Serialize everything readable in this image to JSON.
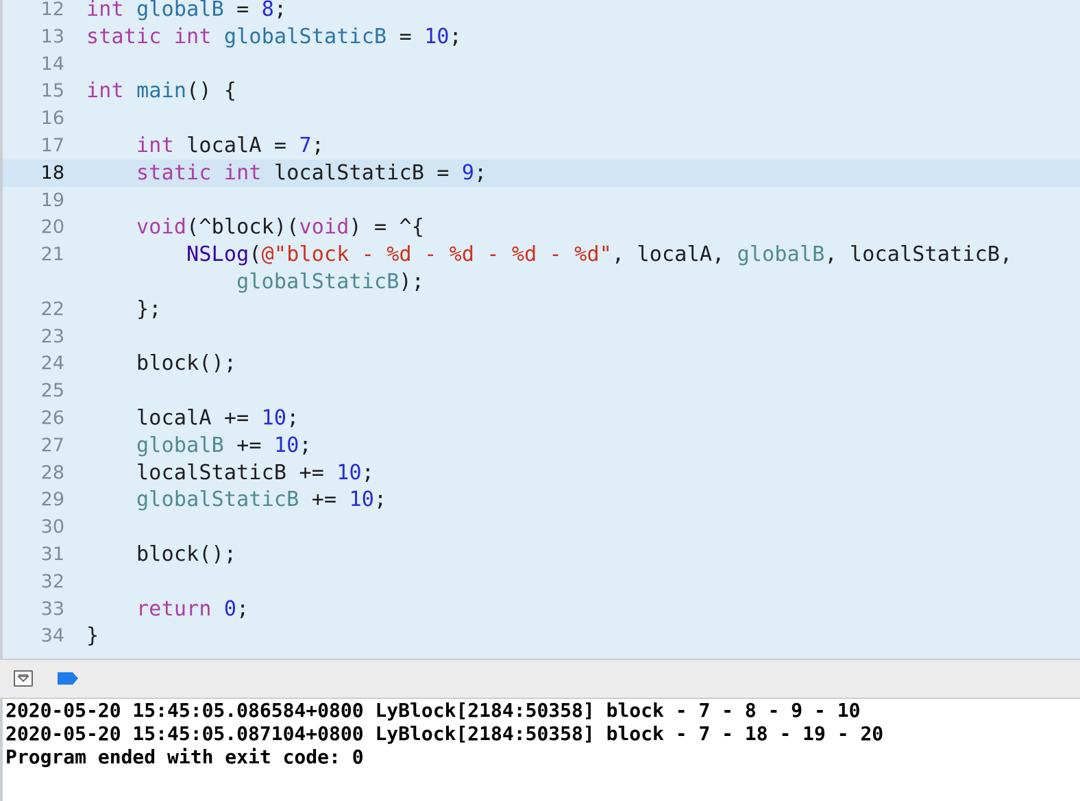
{
  "editor": {
    "current_line": "18",
    "lines": [
      {
        "num": "12",
        "tokens": [
          {
            "t": "int",
            "c": "keyword"
          },
          {
            "t": " ",
            "c": "plain"
          },
          {
            "t": "globalB",
            "c": "decl"
          },
          {
            "t": " = ",
            "c": "plain"
          },
          {
            "t": "8",
            "c": "number"
          },
          {
            "t": ";",
            "c": "plain"
          }
        ]
      },
      {
        "num": "13",
        "tokens": [
          {
            "t": "static",
            "c": "keyword"
          },
          {
            "t": " ",
            "c": "plain"
          },
          {
            "t": "int",
            "c": "keyword"
          },
          {
            "t": " ",
            "c": "plain"
          },
          {
            "t": "globalStaticB",
            "c": "decl"
          },
          {
            "t": " = ",
            "c": "plain"
          },
          {
            "t": "10",
            "c": "number"
          },
          {
            "t": ";",
            "c": "plain"
          }
        ]
      },
      {
        "num": "14",
        "tokens": []
      },
      {
        "num": "15",
        "tokens": [
          {
            "t": "int",
            "c": "keyword"
          },
          {
            "t": " ",
            "c": "plain"
          },
          {
            "t": "main",
            "c": "decl"
          },
          {
            "t": "() {",
            "c": "plain"
          }
        ]
      },
      {
        "num": "16",
        "tokens": []
      },
      {
        "num": "17",
        "tokens": [
          {
            "t": "    ",
            "c": "plain"
          },
          {
            "t": "int",
            "c": "keyword"
          },
          {
            "t": " localA = ",
            "c": "plain"
          },
          {
            "t": "7",
            "c": "number"
          },
          {
            "t": ";",
            "c": "plain"
          }
        ]
      },
      {
        "num": "18",
        "tokens": [
          {
            "t": "    ",
            "c": "plain"
          },
          {
            "t": "static",
            "c": "keyword"
          },
          {
            "t": " ",
            "c": "plain"
          },
          {
            "t": "int",
            "c": "keyword"
          },
          {
            "t": " localStaticB = ",
            "c": "plain"
          },
          {
            "t": "9",
            "c": "number"
          },
          {
            "t": ";",
            "c": "plain"
          }
        ]
      },
      {
        "num": "19",
        "tokens": []
      },
      {
        "num": "20",
        "tokens": [
          {
            "t": "    ",
            "c": "plain"
          },
          {
            "t": "void",
            "c": "keyword"
          },
          {
            "t": "(^block)(",
            "c": "plain"
          },
          {
            "t": "void",
            "c": "keyword"
          },
          {
            "t": ") = ^{",
            "c": "plain"
          }
        ]
      },
      {
        "num": "21",
        "tokens": [
          {
            "t": "        ",
            "c": "plain"
          },
          {
            "t": "NSLog",
            "c": "func"
          },
          {
            "t": "(",
            "c": "plain"
          },
          {
            "t": "@\"block - %d - %d - %d - %d\"",
            "c": "string"
          },
          {
            "t": ", localA, ",
            "c": "plain"
          },
          {
            "t": "globalB",
            "c": "global"
          },
          {
            "t": ", localStaticB,",
            "c": "plain"
          }
        ]
      },
      {
        "num": "",
        "tokens": [
          {
            "t": "            ",
            "c": "plain"
          },
          {
            "t": "globalStaticB",
            "c": "global"
          },
          {
            "t": ");",
            "c": "plain"
          }
        ]
      },
      {
        "num": "22",
        "tokens": [
          {
            "t": "    };",
            "c": "plain"
          }
        ]
      },
      {
        "num": "23",
        "tokens": []
      },
      {
        "num": "24",
        "tokens": [
          {
            "t": "    block();",
            "c": "plain"
          }
        ]
      },
      {
        "num": "25",
        "tokens": []
      },
      {
        "num": "26",
        "tokens": [
          {
            "t": "    localA += ",
            "c": "plain"
          },
          {
            "t": "10",
            "c": "number"
          },
          {
            "t": ";",
            "c": "plain"
          }
        ]
      },
      {
        "num": "27",
        "tokens": [
          {
            "t": "    ",
            "c": "plain"
          },
          {
            "t": "globalB",
            "c": "global"
          },
          {
            "t": " += ",
            "c": "plain"
          },
          {
            "t": "10",
            "c": "number"
          },
          {
            "t": ";",
            "c": "plain"
          }
        ]
      },
      {
        "num": "28",
        "tokens": [
          {
            "t": "    localStaticB += ",
            "c": "plain"
          },
          {
            "t": "10",
            "c": "number"
          },
          {
            "t": ";",
            "c": "plain"
          }
        ]
      },
      {
        "num": "29",
        "tokens": [
          {
            "t": "    ",
            "c": "plain"
          },
          {
            "t": "globalStaticB",
            "c": "global"
          },
          {
            "t": " += ",
            "c": "plain"
          },
          {
            "t": "10",
            "c": "number"
          },
          {
            "t": ";",
            "c": "plain"
          }
        ]
      },
      {
        "num": "30",
        "tokens": []
      },
      {
        "num": "31",
        "tokens": [
          {
            "t": "    block();",
            "c": "plain"
          }
        ]
      },
      {
        "num": "32",
        "tokens": []
      },
      {
        "num": "33",
        "tokens": [
          {
            "t": "    ",
            "c": "plain"
          },
          {
            "t": "return",
            "c": "keyword"
          },
          {
            "t": " ",
            "c": "plain"
          },
          {
            "t": "0",
            "c": "number"
          },
          {
            "t": ";",
            "c": "plain"
          }
        ]
      },
      {
        "num": "34",
        "tokens": [
          {
            "t": "}",
            "c": "plain"
          }
        ]
      }
    ]
  },
  "console_toolbar": {
    "hide_console_icon": "chevron-down-box-icon",
    "breakpoints_icon": "breakpoint-icon",
    "breakpoint_color": "#1f7ce8"
  },
  "console": {
    "lines": [
      "2020-05-20 15:45:05.086584+0800 LyBlock[2184:50358] block - 7 - 8 - 9 - 10",
      "2020-05-20 15:45:05.087104+0800 LyBlock[2184:50358] block - 7 - 18 - 19 - 20",
      "Program ended with exit code: 0"
    ]
  }
}
